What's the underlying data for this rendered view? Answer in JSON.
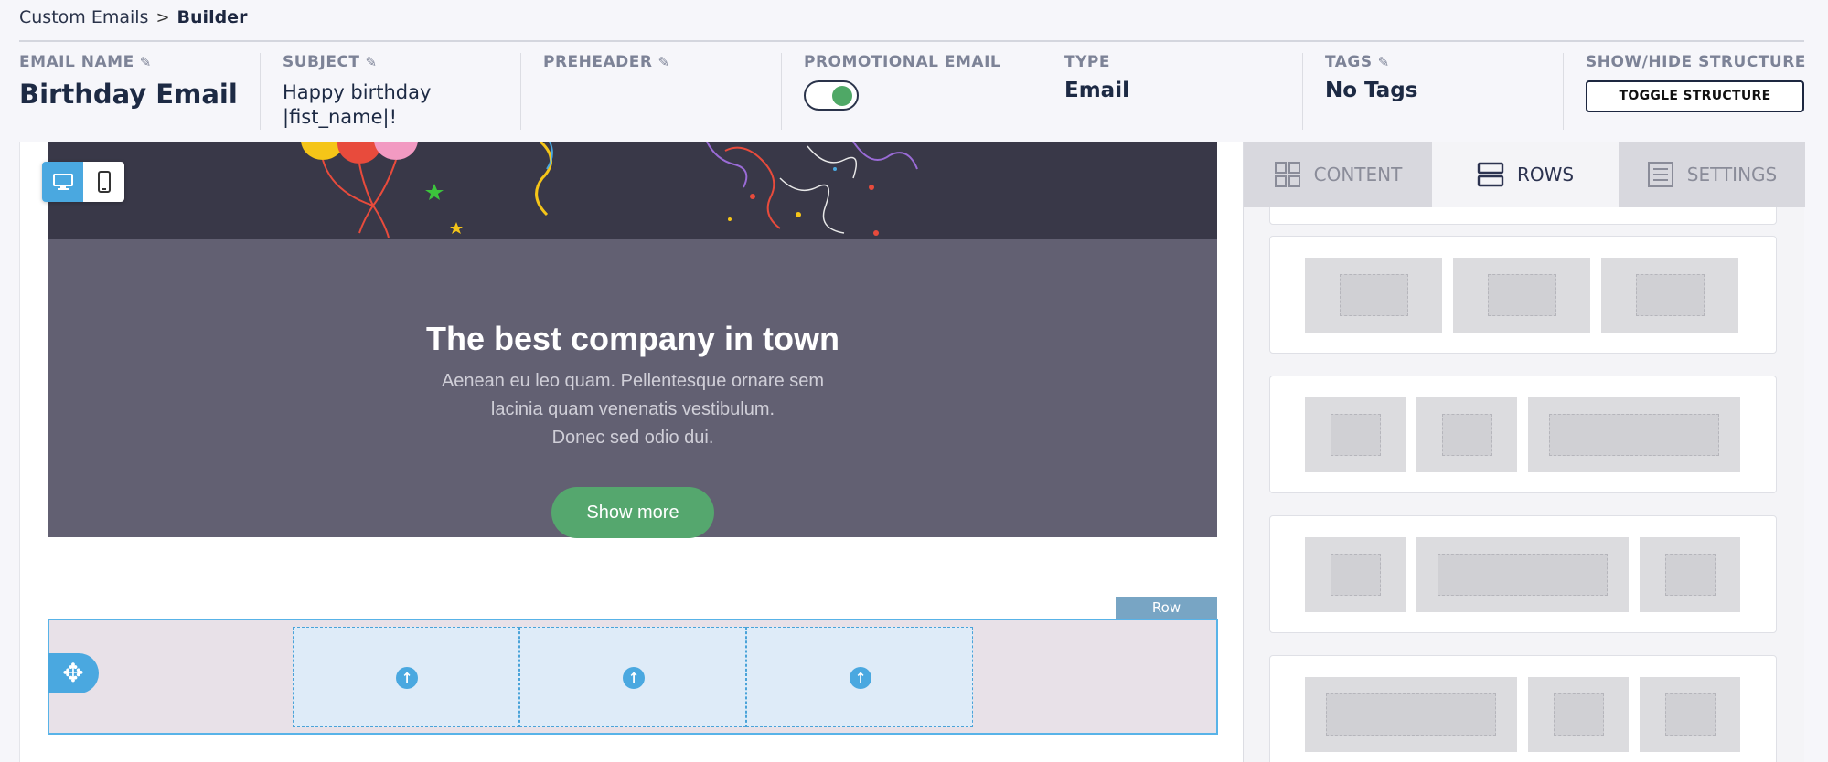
{
  "breadcrumb": {
    "parent": "Custom Emails",
    "separator": ">",
    "current": "Builder"
  },
  "header": {
    "email_name": {
      "label": "EMAIL NAME",
      "value": "Birthday Email"
    },
    "subject": {
      "label": "SUBJECT",
      "value_line1": "Happy birthday",
      "value_line2": "|fist_name|!"
    },
    "preheader": {
      "label": "PREHEADER",
      "value": ""
    },
    "promotional": {
      "label": "PROMOTIONAL EMAIL",
      "enabled": true
    },
    "type": {
      "label": "TYPE",
      "value": "Email"
    },
    "tags": {
      "label": "TAGS",
      "value": "No Tags"
    },
    "structure": {
      "label": "SHOW/HIDE STRUCTURE",
      "button": "TOGGLE STRUCTURE"
    }
  },
  "email": {
    "title": "The best company in town",
    "text_line1": "Aenean eu leo quam. Pellentesque ornare sem",
    "text_line2": "lacinia quam venenatis vestibulum.",
    "text_line3": "Donec sed odio dui.",
    "button": "Show more",
    "row_tag": "Row"
  },
  "panel": {
    "tabs": [
      {
        "label": "CONTENT",
        "icon": "grid-icon"
      },
      {
        "label": "ROWS",
        "icon": "rows-icon",
        "active": true
      },
      {
        "label": "SETTINGS",
        "icon": "settings-doc-icon"
      }
    ]
  },
  "colors": {
    "accent": "#4aa8e0",
    "hero_bg": "#626072",
    "button_green": "#55a76e",
    "toggle_on": "#4fa866"
  }
}
